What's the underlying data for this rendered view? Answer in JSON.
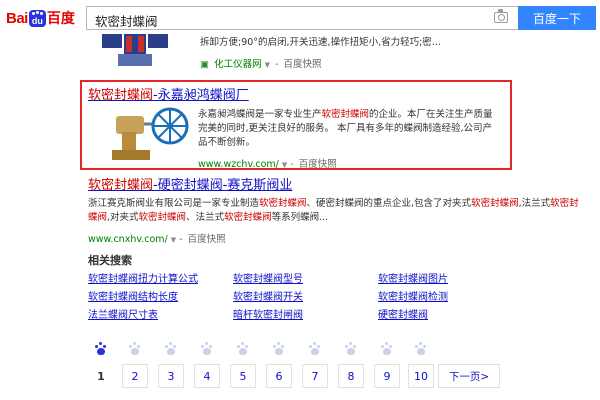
{
  "header": {
    "logo_left": "Bai",
    "logo_paw": "du",
    "logo_right": "百度",
    "search_value": "软密封蝶阀",
    "search_button": "百度一下",
    "camera": "camera-icon"
  },
  "results": [
    {
      "snippet": "拆卸方便;90°的启闭,开关迅速,操作扭矩小,省力轻巧;密...",
      "url": "化工仪器网",
      "snapshot": "百度快照"
    },
    {
      "title_em": "软密封蝶阀",
      "title_rest": "-永嘉昶鸿蝶阀厂",
      "snippet_1": "永嘉昶鸿蝶阀是一家专业生产",
      "snippet_em": "软密封蝶阀",
      "snippet_2": "的企业。本厂在关注生产质量完美的同时,更关注良好的服务。 本厂具有多年的蝶阀制造经验,公司产品不断创新。",
      "url": "www.wzchv.com/",
      "snapshot": "百度快照"
    },
    {
      "title_em1": "软密封蝶阀",
      "title_mid": "-硬密封蝶阀-赛克斯阀业",
      "snippet_a": "浙江赛克斯阀业有限公司是一家专业制造",
      "em_a": "软密封蝶阀",
      "snippet_b": "、硬密封蝶阀的重点企业,包含了对夹式",
      "em_b": "软密封蝶阀",
      "snippet_c": ",法兰式",
      "em_c": "软密封蝶阀",
      "snippet_d": ",对夹式",
      "em_d": "软密封蝶阀",
      "snippet_e": "、法兰式",
      "em_e": "软密封蝶阀",
      "snippet_f": "等系列蝶阀...",
      "url": "www.cnxhv.com/",
      "snapshot": "百度快照"
    }
  ],
  "related": {
    "title": "相关搜索",
    "items": [
      "软密封蝶阀扭力计算公式",
      "软密封蝶阀型号",
      "软密封蝶阀图片",
      "软密封蝶阀结构长度",
      "软密封蝶阀开关",
      "软密封蝶阀检测",
      "法兰蝶阀尺寸表",
      "暗杆软密封闸阀",
      "硬密封蝶阀"
    ]
  },
  "pager": {
    "pages": [
      "1",
      "2",
      "3",
      "4",
      "5",
      "6",
      "7",
      "8",
      "9",
      "10"
    ],
    "current": "1",
    "next": "下一页>"
  }
}
